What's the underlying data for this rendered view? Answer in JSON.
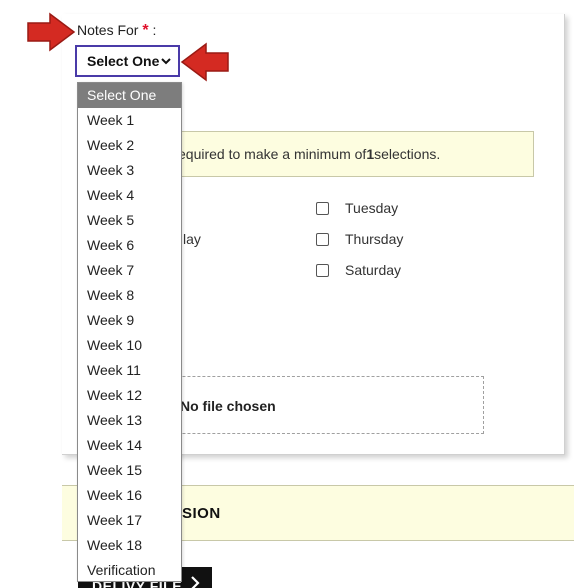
{
  "form": {
    "notes_label": "Notes For",
    "required_mark": "*",
    "colon": ":",
    "select_value": "Select One"
  },
  "notice": {
    "text_prefix": "equired to make a minimum of ",
    "min_count": "1",
    "text_suffix": " selections."
  },
  "days": {
    "tuesday": "Tuesday",
    "thursday": "Thursday",
    "saturday": "Saturday",
    "partial_day": "lay"
  },
  "file": {
    "status": "No file chosen"
  },
  "session": {
    "partial_title": "SION"
  },
  "button": {
    "partial_label": "DELIVY FILE"
  },
  "dropdown": {
    "options": [
      "Select One",
      "Week 1",
      "Week 2",
      "Week 3",
      "Week 4",
      "Week 5",
      "Week 6",
      "Week 7",
      "Week 8",
      "Week 9",
      "Week 10",
      "Week 11",
      "Week 12",
      "Week 13",
      "Week 14",
      "Week 15",
      "Week 16",
      "Week 17",
      "Week 18",
      "Verification"
    ],
    "selected_index": 0
  },
  "colors": {
    "arrow": "#d42a22",
    "select_border": "#4a3aa8",
    "required": "#e0102a",
    "notice_bg": "#fdfde0",
    "selected_option_bg": "#7d7d7d"
  },
  "icons": {
    "annotation": "pointer-arrow-icon",
    "select_chevron": "chevron-down-icon",
    "button_chevron": "chevron-right-icon"
  }
}
